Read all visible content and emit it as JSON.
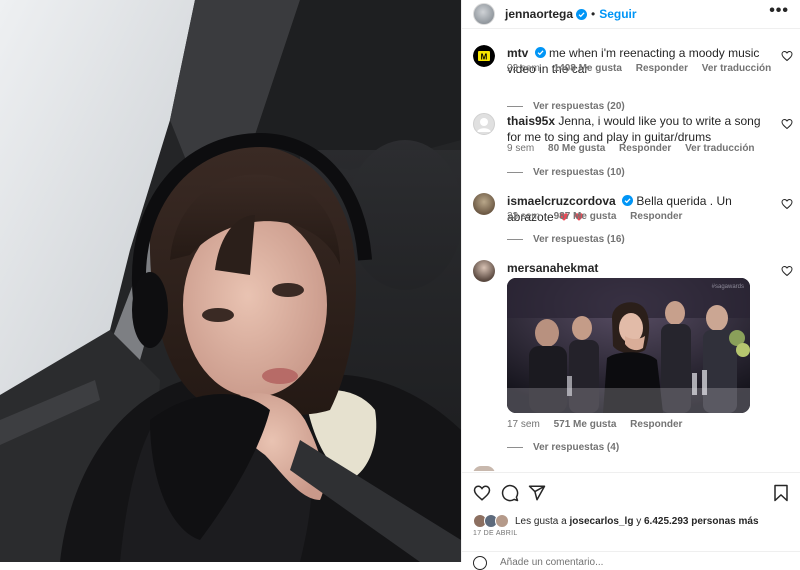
{
  "header": {
    "username": "jennaortega",
    "separator": "•",
    "follow_label": "Seguir",
    "more_label": "•••"
  },
  "comments": [
    {
      "username": "mtv",
      "avatar_text": "M",
      "verified": true,
      "text": "me when i'm reenacting a moody music video in the car",
      "time": "23 sem",
      "likes": "1408 Me gusta",
      "reply": "Responder",
      "translate": "Ver traducción",
      "view_replies": "Ver respuestas (20)"
    },
    {
      "username": "thais95x",
      "verified": false,
      "text": "Jenna, i would like you to write a song for me to sing and play in guitar/drums",
      "time": "9 sem",
      "likes": "80 Me gusta",
      "reply": "Responder",
      "translate": "Ver traducción",
      "view_replies": "Ver respuestas (10)"
    },
    {
      "username": "ismaelcruzcordova",
      "verified": true,
      "text": "Bella querida . Un abrazote",
      "time": "23 sem",
      "likes": "987 Me gusta",
      "reply": "Responder",
      "view_replies": "Ver respuestas (16)"
    },
    {
      "username": "mersanahekmat",
      "verified": false,
      "gif_watermark": "#sagawards",
      "time": "17 sem",
      "likes": "571 Me gusta",
      "reply": "Responder",
      "view_replies": "Ver respuestas (4)"
    }
  ],
  "actions": {
    "likes_prefix": "Les gusta a",
    "liked_by": "josecarlos_lg",
    "likes_joiner": "y",
    "likes_count": "6.425.293 personas más",
    "date": "17 DE ABRIL",
    "add_comment_placeholder": "Añade un comentario..."
  },
  "colors": {
    "accent": "#0095f6",
    "heart_red": "#ed4956",
    "mtv_yellow": "#f7e600"
  },
  "icons": [
    "verified-badge-icon",
    "more-options-icon",
    "heart-icon",
    "comment-icon",
    "share-icon",
    "save-bookmark-icon",
    "emoji-icon"
  ]
}
